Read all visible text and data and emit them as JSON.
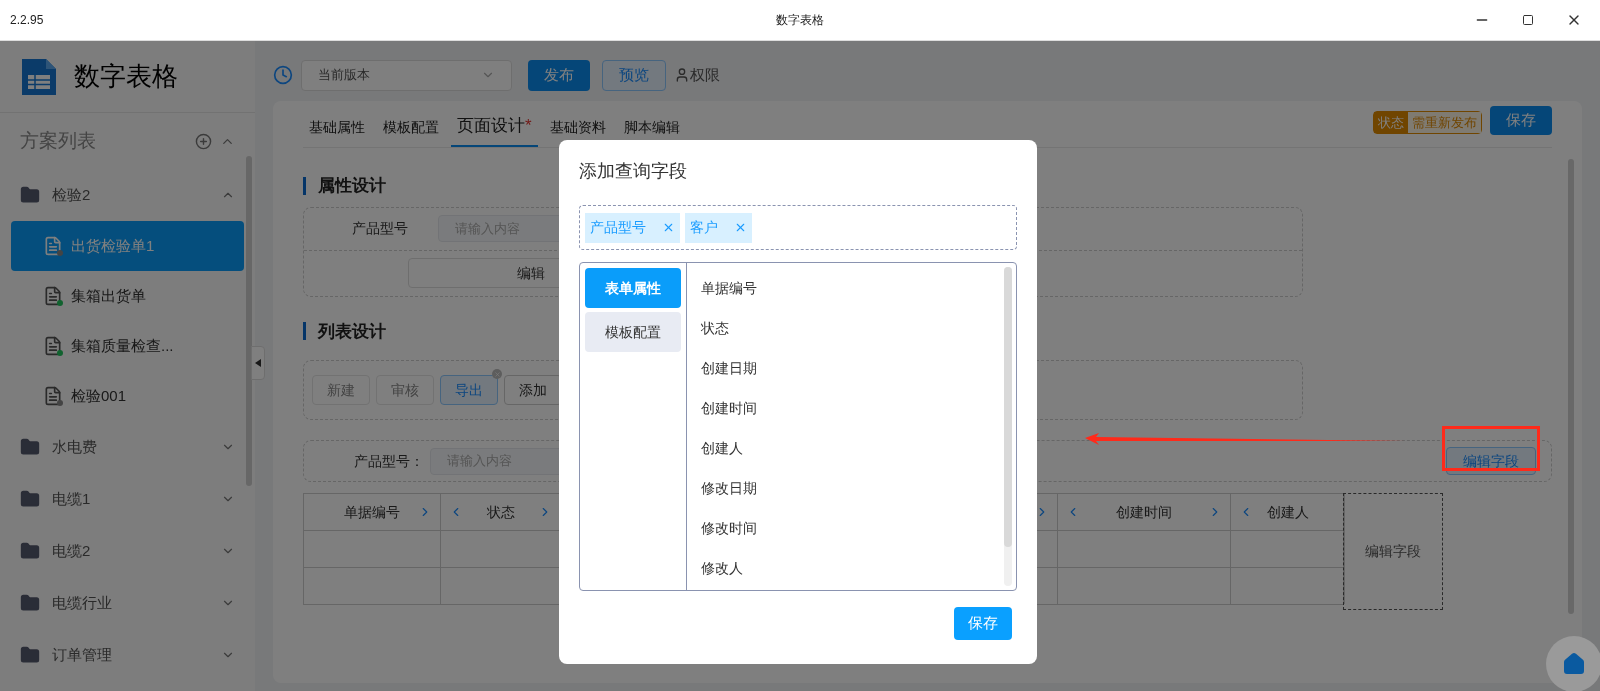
{
  "window": {
    "version": "2.2.95",
    "title": "数字表格"
  },
  "sidebar": {
    "app_name": "数字表格",
    "list_title": "方案列表",
    "groups": [
      {
        "label": "检验2",
        "expanded": true,
        "children": [
          {
            "label": "出货检验单1",
            "selected": true,
            "published": false
          },
          {
            "label": "集箱出货单",
            "selected": false,
            "published": true
          },
          {
            "label": "集箱质量检查...",
            "selected": false,
            "published": true
          },
          {
            "label": "检验001",
            "selected": false,
            "published": false
          }
        ]
      },
      {
        "label": "水电费",
        "expanded": false
      },
      {
        "label": "电缆1",
        "expanded": false
      },
      {
        "label": "电缆2",
        "expanded": false
      },
      {
        "label": "电缆行业",
        "expanded": false
      },
      {
        "label": "订单管理",
        "expanded": false
      }
    ]
  },
  "toolbar": {
    "version_select": "当前版本",
    "publish": "发布",
    "preview": "预览",
    "permissions": "权限"
  },
  "tabs": [
    {
      "label": "基础属性",
      "selected": false,
      "modified": false
    },
    {
      "label": "模板配置",
      "selected": false,
      "modified": false
    },
    {
      "label": "页面设计",
      "selected": true,
      "modified": true
    },
    {
      "label": "基础资料",
      "selected": false,
      "modified": false
    },
    {
      "label": "脚本编辑",
      "selected": false,
      "modified": false
    }
  ],
  "modified_marker": "*",
  "status": {
    "label": "状态",
    "value": "需重新发布"
  },
  "save": "保存",
  "attribute_design": {
    "title": "属性设计",
    "field_label": "产品型号",
    "placeholder": "请输入内容",
    "edit_button": "编辑"
  },
  "list_design": {
    "title": "列表设计",
    "buttons": [
      {
        "label": "新建",
        "disabled": true,
        "selected": false
      },
      {
        "label": "审核",
        "disabled": true,
        "selected": false
      },
      {
        "label": "导出",
        "disabled": false,
        "selected": true
      },
      {
        "label": "添加",
        "disabled": false,
        "selected": false
      }
    ],
    "filter_label": "产品型号：",
    "filter_placeholder": "请输入内容",
    "edit_fields_button": "编辑字段",
    "columns": [
      {
        "label": "单据编号",
        "prev": false,
        "next": true
      },
      {
        "label": "状态",
        "prev": true,
        "next": true
      },
      {
        "label": "创建时间",
        "prev": true,
        "next": true
      },
      {
        "label": "创建人",
        "prev": true,
        "next": false
      }
    ],
    "add_column": "编辑字段"
  },
  "dialog": {
    "title": "添加查询字段",
    "tags": [
      "产品型号",
      "客户"
    ],
    "categories": [
      {
        "label": "表单属性",
        "selected": true
      },
      {
        "label": "模板配置",
        "selected": false
      }
    ],
    "fields": [
      "单据编号",
      "状态",
      "创建日期",
      "创建时间",
      "创建人",
      "修改日期",
      "修改时间",
      "修改人"
    ],
    "save": "保存"
  }
}
